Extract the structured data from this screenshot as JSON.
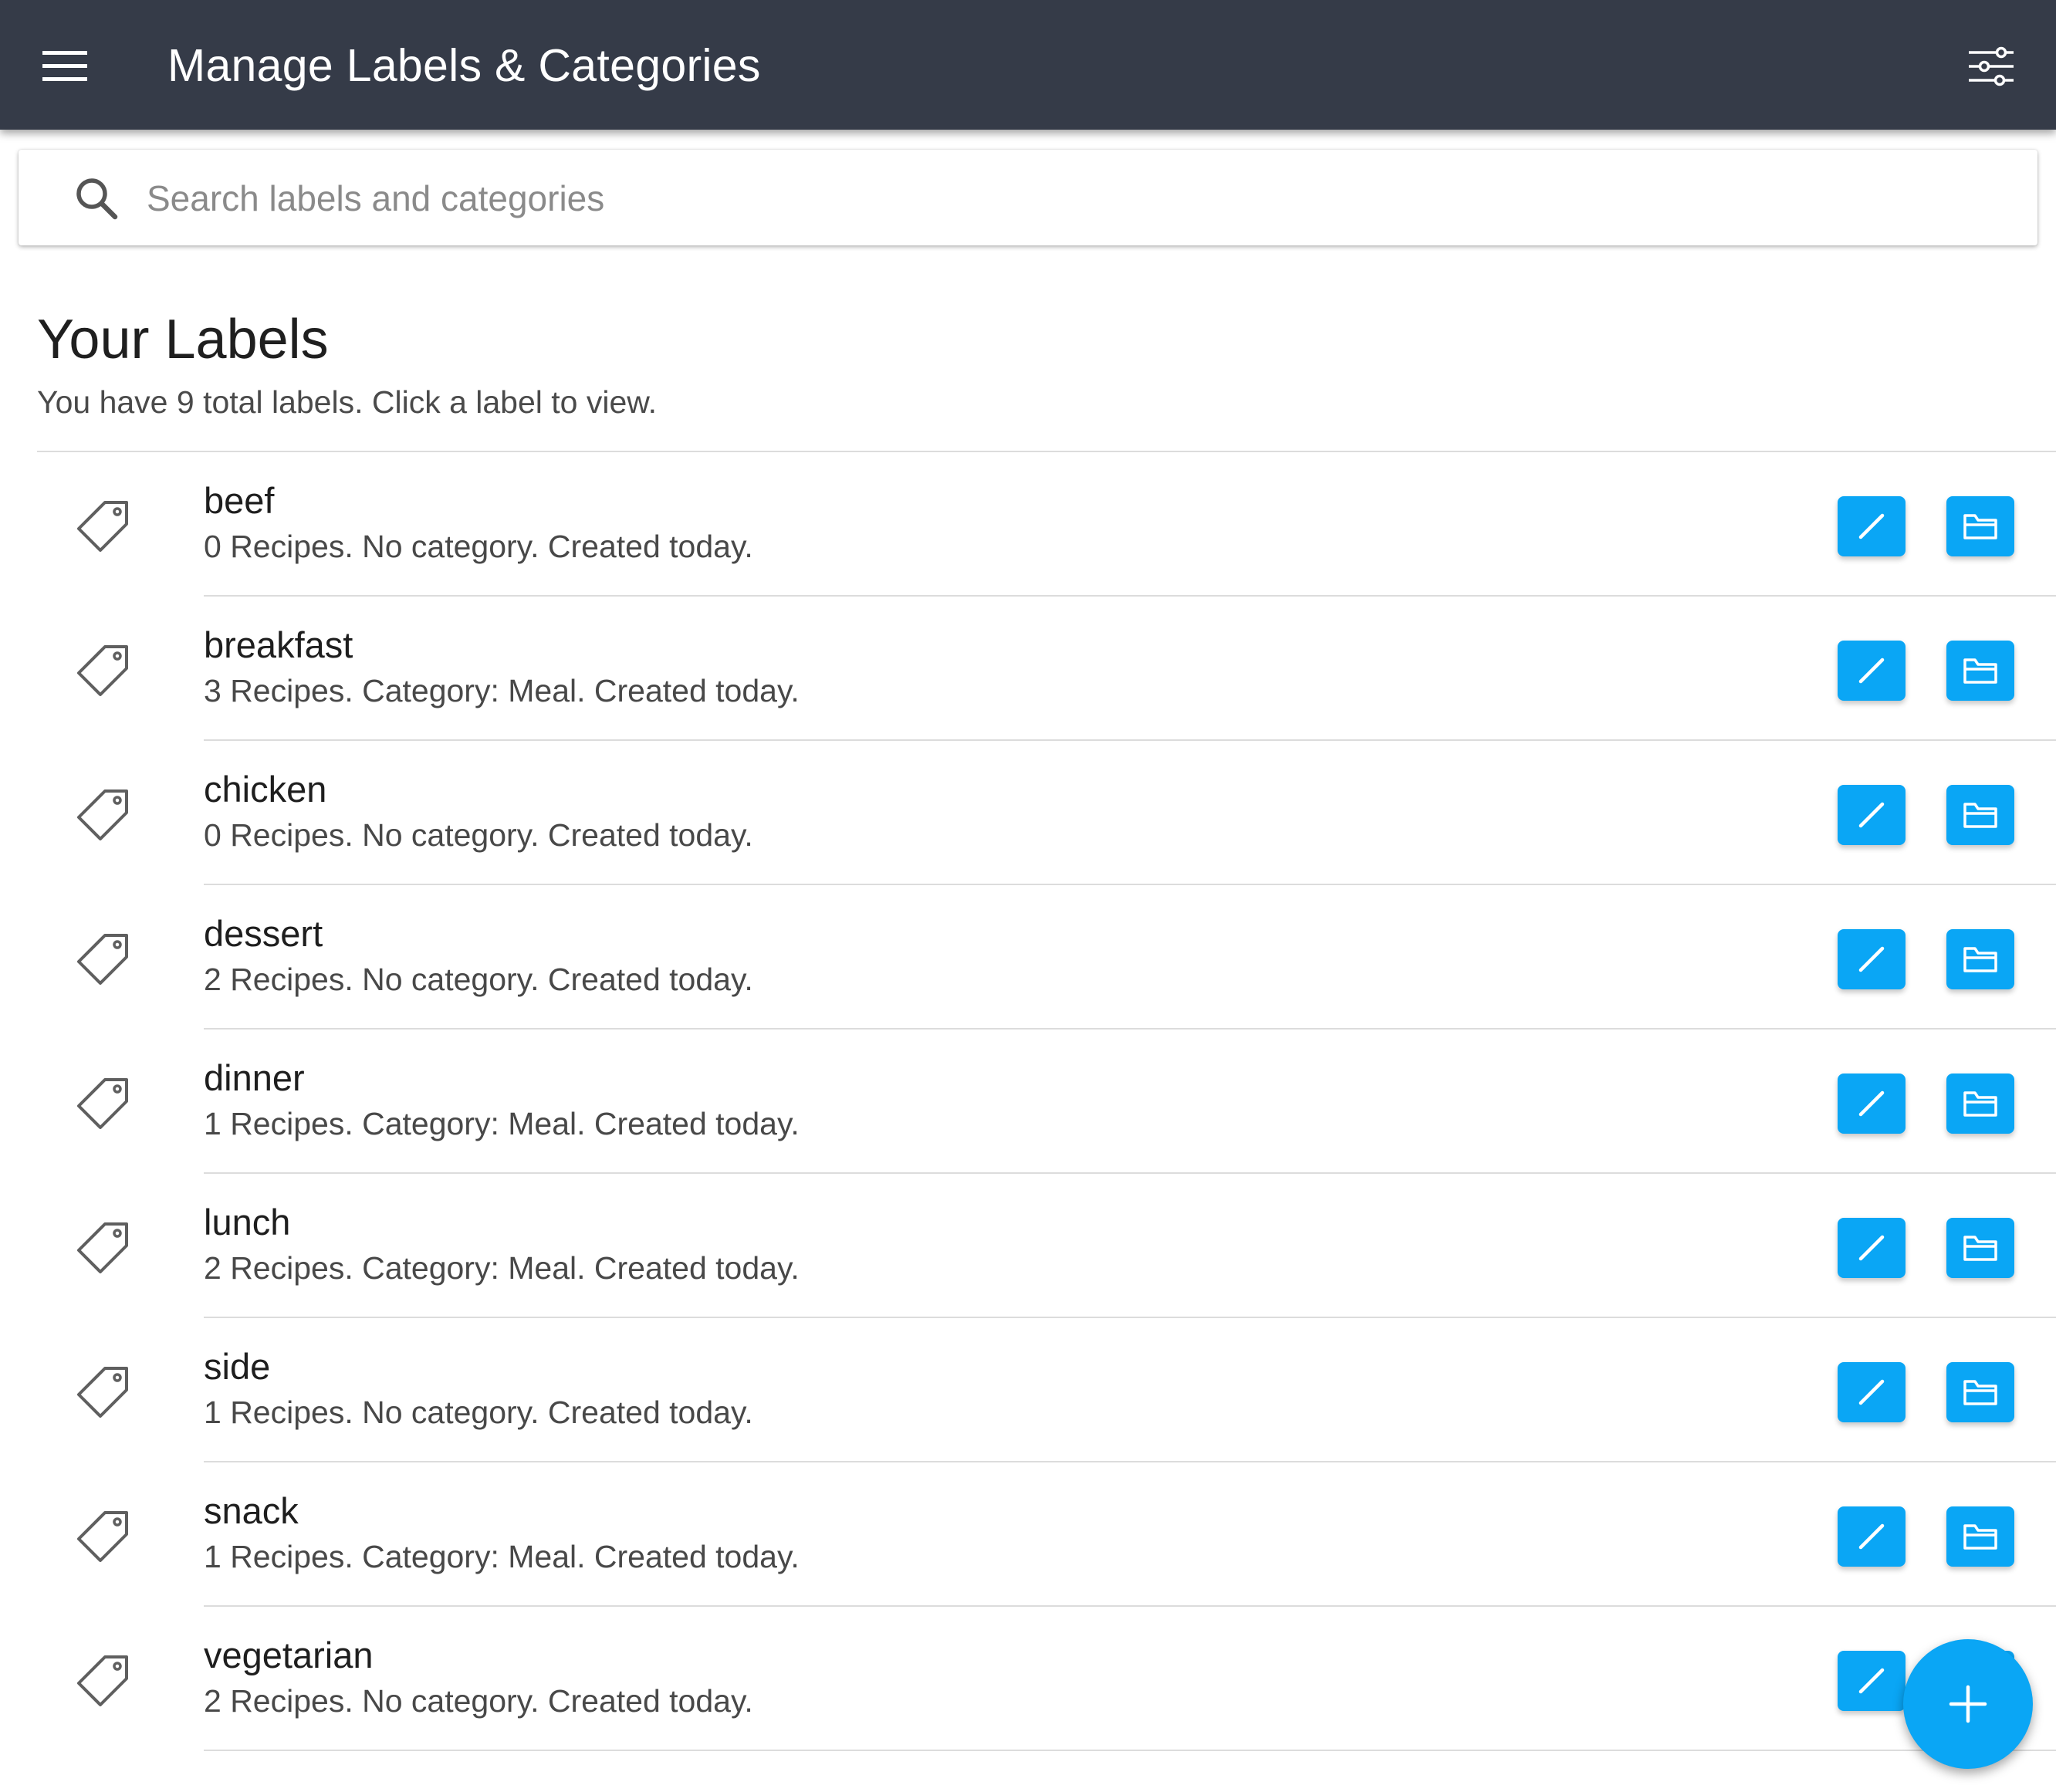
{
  "header": {
    "title": "Manage Labels & Categories",
    "menu_icon": "hamburger-menu-icon",
    "filter_icon": "sliders-filter-icon",
    "background_color": "#353b48"
  },
  "search": {
    "placeholder": "Search labels and categories",
    "value": "",
    "icon": "search-icon"
  },
  "labels_section": {
    "title": "Your Labels",
    "subtitle": "You have 9 total labels. Click a label to view.",
    "items": [
      {
        "name": "beef",
        "meta": "0 Recipes. No category. Created today."
      },
      {
        "name": "breakfast",
        "meta": "3 Recipes. Category: Meal. Created today."
      },
      {
        "name": "chicken",
        "meta": "0 Recipes. No category. Created today."
      },
      {
        "name": "dessert",
        "meta": "2 Recipes. No category. Created today."
      },
      {
        "name": "dinner",
        "meta": "1 Recipes. Category: Meal. Created today."
      },
      {
        "name": "lunch",
        "meta": "2 Recipes. Category: Meal. Created today."
      },
      {
        "name": "side",
        "meta": "1 Recipes. No category. Created today."
      },
      {
        "name": "snack",
        "meta": "1 Recipes. Category: Meal. Created today."
      },
      {
        "name": "vegetarian",
        "meta": "2 Recipes. No category. Created today."
      }
    ],
    "item_icon": "tag-icon",
    "edit_icon": "pencil-icon",
    "category_icon": "folder-icon"
  },
  "fab": {
    "icon": "plus-icon"
  },
  "colors": {
    "accent": "#0aa6f5",
    "divider": "#dcdcdc"
  }
}
